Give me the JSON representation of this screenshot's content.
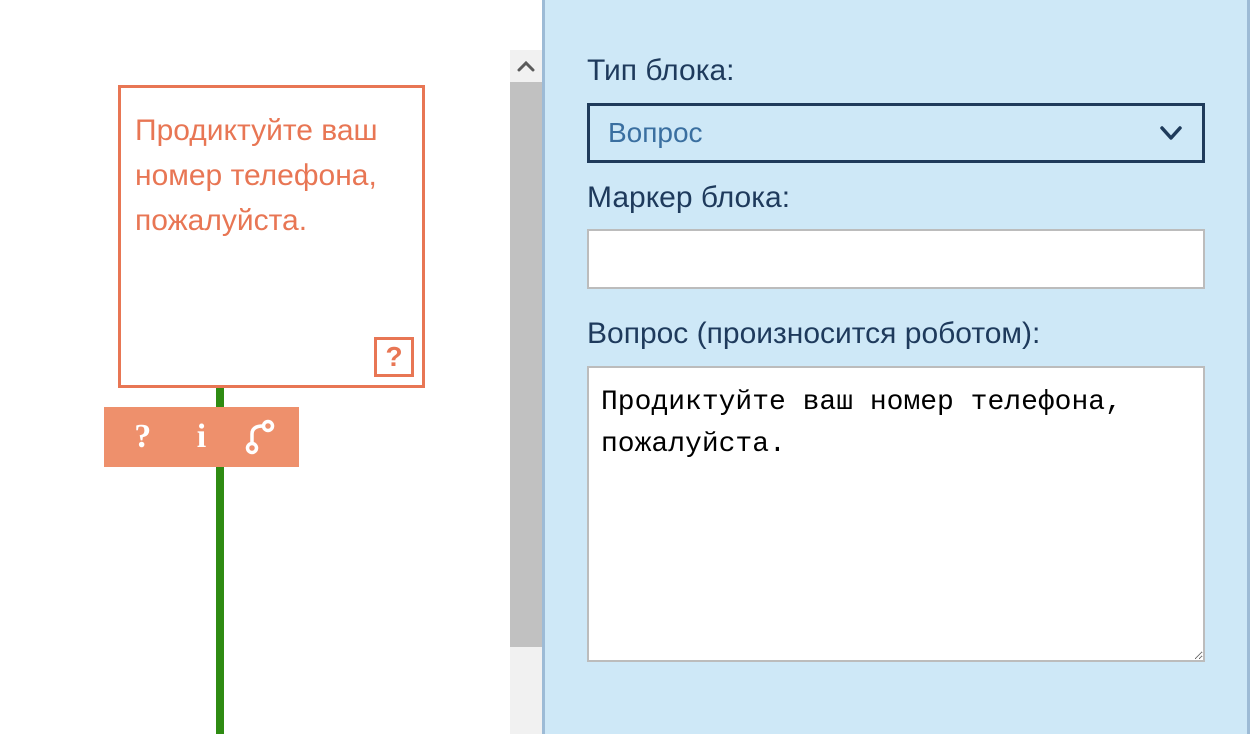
{
  "canvas": {
    "node_text": "Продиктуйте ваш номер телефона, пожалуйста.",
    "node_badge": "?",
    "toolbar": {
      "question": "?",
      "info": "i",
      "branch": "branch-icon"
    }
  },
  "panel": {
    "block_type_label": "Тип блока:",
    "block_type_value": "Вопрос",
    "block_marker_label": "Маркер блока:",
    "block_marker_value": "",
    "question_label": "Вопрос (произносится роботом):",
    "question_value": "Продиктуйте ваш номер телефона, пожалуйста."
  }
}
